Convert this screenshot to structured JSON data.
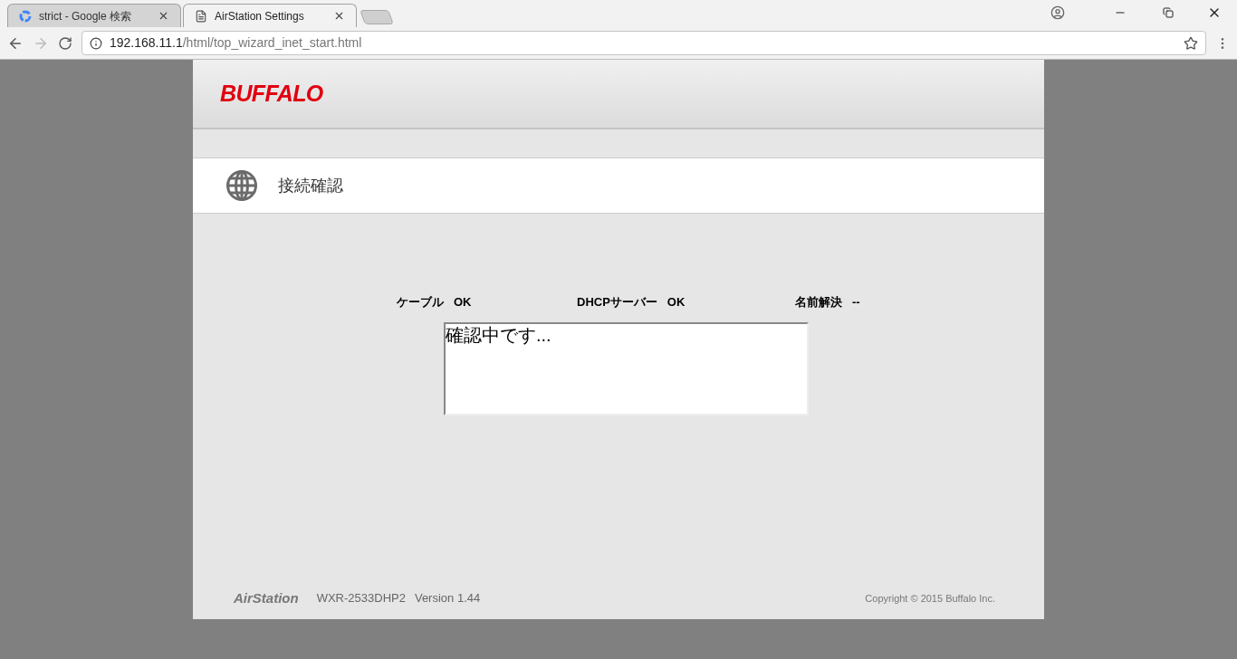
{
  "browser": {
    "tabs": [
      {
        "title": "strict - Google 検索",
        "selected": false,
        "kind": "google"
      },
      {
        "title": "AirStation Settings",
        "selected": true,
        "kind": "page"
      }
    ],
    "address": {
      "host": "192.168.11.1",
      "path": "/html/top_wizard_inet_start.html"
    }
  },
  "page": {
    "logo": "BUFFALO",
    "section_title": "接続確認",
    "status": [
      {
        "label": "ケーブル",
        "value": "OK"
      },
      {
        "label": "DHCPサーバー",
        "value": "OK"
      },
      {
        "label": "名前解決",
        "value": "--"
      }
    ],
    "log": "確認中です...",
    "footer": {
      "brand": "AirStation",
      "model": "WXR-2533DHP2",
      "version": "Version 1.44",
      "copyright": "Copyright © 2015 Buffalo Inc."
    }
  }
}
